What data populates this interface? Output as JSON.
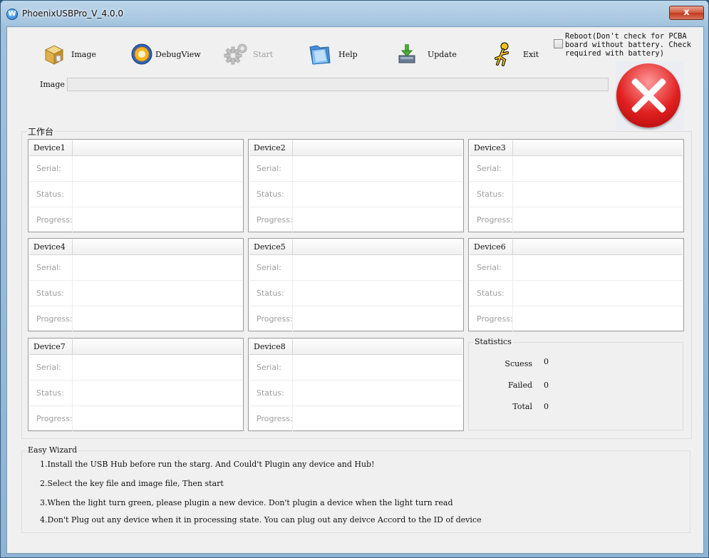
{
  "window": {
    "title": "PhoenixUSBPro_V_4.0.0",
    "close_glyph": "x"
  },
  "toolbar": {
    "image": {
      "label": "Image",
      "icon": "box-icon"
    },
    "debugview": {
      "label": "DebugView",
      "icon": "debug-icon"
    },
    "start": {
      "label": "Start",
      "icon": "gear-icon",
      "enabled": false
    },
    "help": {
      "label": "Help",
      "icon": "folder-icon"
    },
    "update": {
      "label": "Update",
      "icon": "download-icon"
    },
    "exit": {
      "label": "Exit",
      "icon": "running-man-icon"
    }
  },
  "reboot": {
    "checked": false,
    "text": "Reboot(Don't check for PCBA board without battery. Check required with battery)"
  },
  "image_path": {
    "label": "Image",
    "value": ""
  },
  "status_light": {
    "state": "red",
    "color": "#e02020"
  },
  "workbench": {
    "title": "工作台",
    "row_labels": {
      "serial": "Serial:",
      "status": "Status:",
      "progress": "Progress:"
    },
    "devices": [
      {
        "name": "Device1",
        "serial": "",
        "status": "",
        "progress": ""
      },
      {
        "name": "Device2",
        "serial": "",
        "status": "",
        "progress": ""
      },
      {
        "name": "Device3",
        "serial": "",
        "status": "",
        "progress": ""
      },
      {
        "name": "Device4",
        "serial": "",
        "status": "",
        "progress": ""
      },
      {
        "name": "Device5",
        "serial": "",
        "status": "",
        "progress": ""
      },
      {
        "name": "Device6",
        "serial": "",
        "status": "",
        "progress": ""
      },
      {
        "name": "Device7",
        "serial": "",
        "status": "",
        "progress": ""
      },
      {
        "name": "Device8",
        "serial": "",
        "status": "",
        "progress": ""
      }
    ]
  },
  "statistics": {
    "title": "Statistics",
    "success_label": "Scuess",
    "success": "0",
    "failed_label": "Failed",
    "failed": "0",
    "total_label": "Total",
    "total": "0"
  },
  "wizard": {
    "title": "Easy Wizard",
    "steps": [
      "1.Install the USB Hub before run the starg. And Could't Plugin any device and Hub!",
      "2.Select the key file and image file, Then start",
      "3.When the light turn green, please plugin a new device. Don't plugin a device when the light turn read",
      "4.Don't Plug out any device when it in processing state. You can plug out any deivce Accord to the ID of device"
    ]
  }
}
